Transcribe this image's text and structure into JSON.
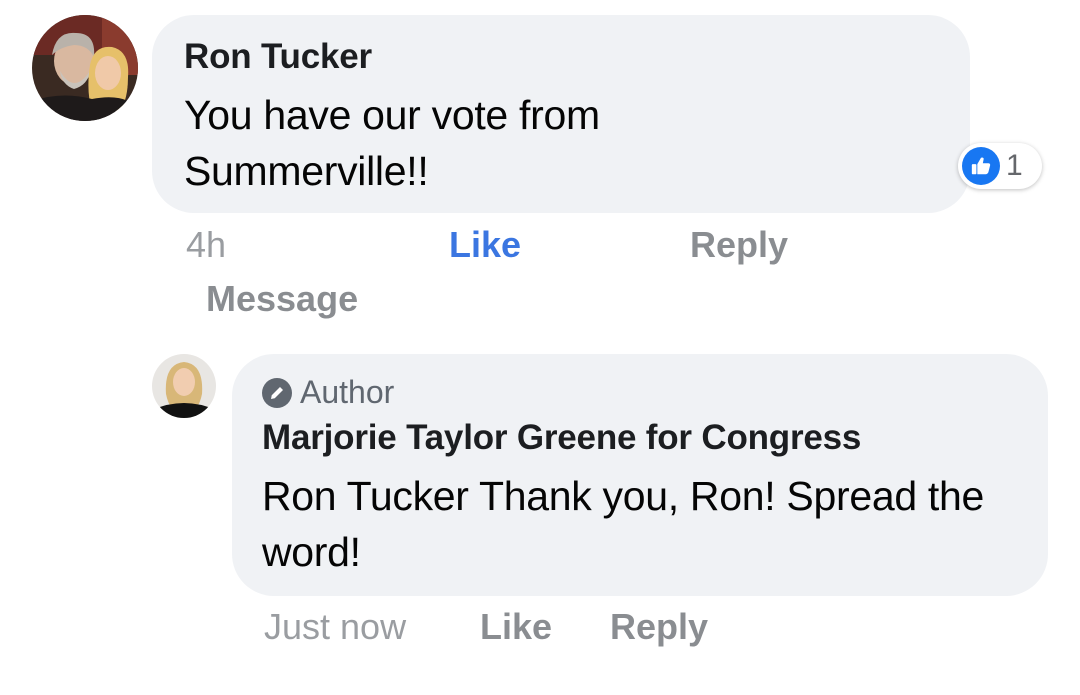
{
  "comments": [
    {
      "author": "Ron Tucker",
      "text": "You have our vote from Summerville!!",
      "reactions": {
        "icon": "like-thumb-icon",
        "count": "1",
        "color": "#1877f2"
      },
      "actions": {
        "time": "4h",
        "like": "Like",
        "reply": "Reply",
        "message": "Message"
      }
    },
    {
      "badge": {
        "icon": "pencil-icon",
        "label": "Author"
      },
      "author": "Marjorie Taylor Greene for Congress",
      "text": "Ron Tucker Thank you, Ron! Spread the word!",
      "actions": {
        "time": "Just now",
        "like": "Like",
        "reply": "Reply"
      }
    }
  ],
  "colors": {
    "bubble": "#f0f2f5",
    "liked": "#3b76e1",
    "muted": "#8a8d91"
  }
}
